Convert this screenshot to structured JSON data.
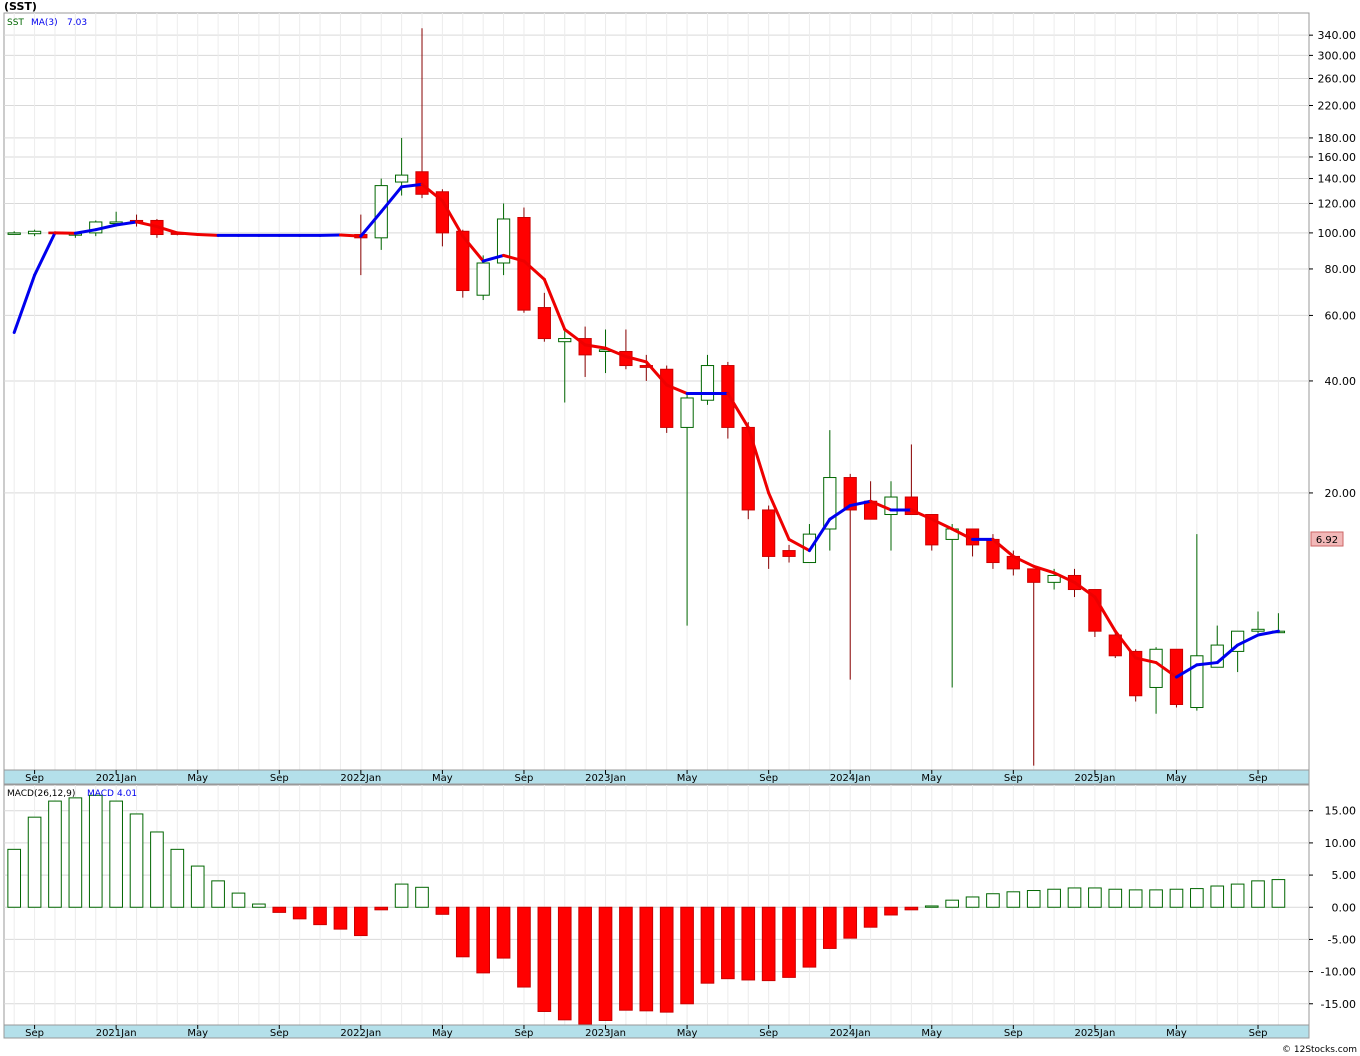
{
  "ticker_title": "(SST)",
  "price_panel": {
    "symbol": "SST",
    "ma_label": "MA(3)",
    "ma_value": "7.03",
    "last_price": "6.92"
  },
  "macd_panel": {
    "label": "MACD(26,12,9)",
    "macd_label": "MACD",
    "macd_value": "4.01"
  },
  "footer": "© 12Stocks.com",
  "colors": {
    "up": "#006600",
    "down": "#cc0000",
    "down_fill": "#ff0000",
    "ma_up": "#0000ee",
    "ma_down": "#ee0000",
    "axis_band": "#b4e0ea",
    "grid": "#d9d9d9",
    "last_price_bg": "#f2b8b8"
  },
  "chart_data": [
    {
      "type": "candlestick",
      "scale": "log",
      "ylim": [
        3.6,
        390
      ],
      "y_ticks": [
        20,
        40,
        60,
        80,
        100,
        120,
        140,
        160,
        180,
        220,
        260,
        300,
        340
      ],
      "y_tick_labels": [
        "20.00",
        "40.00",
        "60.00",
        "80.00",
        "100.00",
        "120.00",
        "140.00",
        "160.00",
        "180.00",
        "220.00",
        "260.00",
        "300.00",
        "340.00"
      ],
      "x_labels": [
        "Sep",
        "2021Jan",
        "May",
        "Sep",
        "2022Jan",
        "May",
        "Sep",
        "2023Jan",
        "May",
        "Sep",
        "2024Jan",
        "May",
        "Sep",
        "2025Jan",
        "May",
        "Sep"
      ],
      "x_label_index": [
        1,
        5,
        9,
        13,
        17,
        21,
        25,
        29,
        33,
        37,
        41,
        45,
        49,
        53,
        57,
        61
      ],
      "candles": [
        {
          "i": 0,
          "o": 100,
          "h": 101,
          "l": 99,
          "c": 100
        },
        {
          "i": 1,
          "o": 99.5,
          "h": 102,
          "l": 98,
          "c": 101
        },
        {
          "i": 2,
          "o": 100.5,
          "h": 101,
          "l": 99,
          "c": 99.5
        },
        {
          "i": 3,
          "o": 99,
          "h": 100,
          "l": 97,
          "c": 99.5
        },
        {
          "i": 4,
          "o": 100,
          "h": 108,
          "l": 98,
          "c": 107
        },
        {
          "i": 5,
          "o": 106,
          "h": 114,
          "l": 104,
          "c": 107
        },
        {
          "i": 6,
          "o": 108,
          "h": 112,
          "l": 104,
          "c": 107
        },
        {
          "i": 7,
          "o": 108,
          "h": 109,
          "l": 97,
          "c": 99
        },
        {
          "i": 8,
          "o": 100,
          "h": 100,
          "l": 98.5,
          "c": 99.5
        },
        {
          "i": 17,
          "o": 99,
          "h": 112,
          "l": 77,
          "c": 97
        },
        {
          "i": 18,
          "o": 97,
          "h": 140,
          "l": 90,
          "c": 134
        },
        {
          "i": 19,
          "o": 137,
          "h": 180,
          "l": 126,
          "c": 143
        },
        {
          "i": 20,
          "o": 146,
          "h": 355,
          "l": 124,
          "c": 127
        },
        {
          "i": 21,
          "o": 129,
          "h": 131,
          "l": 92,
          "c": 100
        },
        {
          "i": 22,
          "o": 101,
          "h": 102,
          "l": 67,
          "c": 70
        },
        {
          "i": 23,
          "o": 68,
          "h": 87,
          "l": 66,
          "c": 83
        },
        {
          "i": 24,
          "o": 83,
          "h": 120,
          "l": 77,
          "c": 109
        },
        {
          "i": 25,
          "o": 110,
          "h": 117,
          "l": 61,
          "c": 62
        },
        {
          "i": 26,
          "o": 63,
          "h": 69,
          "l": 51,
          "c": 52
        },
        {
          "i": 27,
          "o": 51,
          "h": 55,
          "l": 35,
          "c": 52
        },
        {
          "i": 28,
          "o": 52,
          "h": 56,
          "l": 41,
          "c": 47
        },
        {
          "i": 29,
          "o": 48,
          "h": 55,
          "l": 42,
          "c": 48.5
        },
        {
          "i": 30,
          "o": 48,
          "h": 55,
          "l": 43,
          "c": 44
        },
        {
          "i": 31,
          "o": 44,
          "h": 47,
          "l": 40,
          "c": 43.5
        },
        {
          "i": 32,
          "o": 43,
          "h": 44,
          "l": 29,
          "c": 30
        },
        {
          "i": 33,
          "o": 30,
          "h": 37,
          "l": 8.8,
          "c": 36
        },
        {
          "i": 34,
          "o": 35.5,
          "h": 47,
          "l": 34.5,
          "c": 44
        },
        {
          "i": 35,
          "o": 44,
          "h": 45,
          "l": 28,
          "c": 30
        },
        {
          "i": 36,
          "o": 30,
          "h": 31,
          "l": 17,
          "c": 18
        },
        {
          "i": 37,
          "o": 18,
          "h": 18.5,
          "l": 12.5,
          "c": 13.5
        },
        {
          "i": 38,
          "o": 14,
          "h": 14.5,
          "l": 13,
          "c": 13.5
        },
        {
          "i": 39,
          "o": 13,
          "h": 16.5,
          "l": 13,
          "c": 15.5
        },
        {
          "i": 40,
          "o": 16,
          "h": 29.5,
          "l": 14,
          "c": 22
        },
        {
          "i": 41,
          "o": 22,
          "h": 22.5,
          "l": 6.3,
          "c": 18
        },
        {
          "i": 42,
          "o": 19,
          "h": 21.5,
          "l": 17,
          "c": 17
        },
        {
          "i": 43,
          "o": 17.5,
          "h": 21.5,
          "l": 14,
          "c": 19.5
        },
        {
          "i": 44,
          "o": 19.5,
          "h": 27,
          "l": 17.5,
          "c": 17.5
        },
        {
          "i": 45,
          "o": 17.5,
          "h": 17.5,
          "l": 14,
          "c": 14.5
        },
        {
          "i": 46,
          "o": 15,
          "h": 16.5,
          "l": 6.0,
          "c": 16
        },
        {
          "i": 47,
          "o": 16,
          "h": 16,
          "l": 13.5,
          "c": 14.5
        },
        {
          "i": 48,
          "o": 15,
          "h": 15.5,
          "l": 12.5,
          "c": 13
        },
        {
          "i": 49,
          "o": 13.5,
          "h": 14,
          "l": 12,
          "c": 12.5
        },
        {
          "i": 50,
          "o": 12.5,
          "h": 12.5,
          "l": 3.7,
          "c": 11.5
        },
        {
          "i": 51,
          "o": 11.5,
          "h": 12.5,
          "l": 11,
          "c": 12
        },
        {
          "i": 52,
          "o": 12,
          "h": 12.5,
          "l": 10.5,
          "c": 11
        },
        {
          "i": 53,
          "o": 11,
          "h": 11,
          "l": 8.2,
          "c": 8.5
        },
        {
          "i": 54,
          "o": 8.3,
          "h": 8.5,
          "l": 7.2,
          "c": 7.3
        },
        {
          "i": 55,
          "o": 7.5,
          "h": 7.6,
          "l": 5.5,
          "c": 5.7
        },
        {
          "i": 56,
          "o": 6.0,
          "h": 7.7,
          "l": 5.1,
          "c": 7.6
        },
        {
          "i": 57,
          "o": 7.6,
          "h": 7.6,
          "l": 5.3,
          "c": 5.4
        },
        {
          "i": 58,
          "o": 5.3,
          "h": 15.5,
          "l": 5.2,
          "c": 7.3
        },
        {
          "i": 59,
          "o": 6.8,
          "h": 8.8,
          "l": 6.8,
          "c": 7.8
        },
        {
          "i": 60,
          "o": 7.5,
          "h": 8.5,
          "l": 6.6,
          "c": 8.5
        },
        {
          "i": 61,
          "o": 8.5,
          "h": 9.6,
          "l": 8.4,
          "c": 8.6
        },
        {
          "i": 62,
          "o": 8.5,
          "h": 9.5,
          "l": 8.4,
          "c": 8.5
        }
      ],
      "ma_series": {
        "name": "MA(3)",
        "points": [
          [
            0,
            54
          ],
          [
            1,
            77
          ],
          [
            2,
            100
          ],
          [
            3,
            99.8
          ],
          [
            4,
            102
          ],
          [
            5,
            105
          ],
          [
            6,
            107
          ],
          [
            7,
            104
          ],
          [
            8,
            100
          ],
          [
            9,
            99
          ],
          [
            10,
            98.5
          ],
          [
            11,
            98.5
          ],
          [
            12,
            98.5
          ],
          [
            13,
            98.5
          ],
          [
            14,
            98.5
          ],
          [
            15,
            98.5
          ],
          [
            16,
            98.7
          ],
          [
            17,
            98
          ],
          [
            18,
            114
          ],
          [
            19,
            133
          ],
          [
            20,
            135
          ],
          [
            21,
            122
          ],
          [
            22,
            98
          ],
          [
            23,
            84
          ],
          [
            24,
            87
          ],
          [
            25,
            84
          ],
          [
            26,
            75
          ],
          [
            27,
            55
          ],
          [
            28,
            50
          ],
          [
            29,
            49
          ],
          [
            30,
            46.5
          ],
          [
            31,
            45
          ],
          [
            32,
            39
          ],
          [
            33,
            37
          ],
          [
            34,
            37
          ],
          [
            35,
            37
          ],
          [
            36,
            30
          ],
          [
            37,
            20
          ],
          [
            38,
            15
          ],
          [
            39,
            14
          ],
          [
            40,
            17
          ],
          [
            41,
            18.5
          ],
          [
            42,
            19
          ],
          [
            43,
            18
          ],
          [
            44,
            18
          ],
          [
            45,
            17
          ],
          [
            46,
            16
          ],
          [
            47,
            15
          ],
          [
            48,
            15
          ],
          [
            49,
            13.5
          ],
          [
            50,
            12.7
          ],
          [
            51,
            12.2
          ],
          [
            52,
            11.5
          ],
          [
            53,
            10.5
          ],
          [
            54,
            8.5
          ],
          [
            55,
            7.2
          ],
          [
            56,
            7.0
          ],
          [
            57,
            6.4
          ],
          [
            58,
            6.9
          ],
          [
            59,
            7.0
          ],
          [
            60,
            7.8
          ],
          [
            61,
            8.3
          ],
          [
            62,
            8.5
          ]
        ]
      },
      "plot_window": {
        "first_index": -0.5,
        "last_index": 63.5
      }
    },
    {
      "type": "bar",
      "title": "MACD(26,12,9)",
      "ylim": [
        -18.3,
        19
      ],
      "y_ticks": [
        15,
        10,
        5,
        0,
        -5,
        -10,
        -15
      ],
      "y_tick_labels": [
        "15.00",
        "10.00",
        "5.00",
        "0.00",
        "-5.00",
        "-10.00",
        "-15.00"
      ],
      "x_labels": [
        "Sep",
        "2021Jan",
        "May",
        "Sep",
        "2022Jan",
        "May",
        "Sep",
        "2023Jan",
        "May",
        "Sep",
        "2024Jan",
        "May",
        "Sep",
        "2025Jan",
        "May",
        "Sep"
      ],
      "x_label_index": [
        1,
        5,
        9,
        13,
        17,
        21,
        25,
        29,
        33,
        37,
        41,
        45,
        49,
        53,
        57,
        61
      ],
      "values": [
        9,
        14,
        16.5,
        17,
        17.4,
        16.5,
        14.5,
        11.7,
        9,
        6.4,
        4.1,
        2.2,
        0.5,
        -0.8,
        -1.8,
        -2.7,
        -3.4,
        -4.4,
        -0.4,
        3.6,
        3.1,
        -1.1,
        -7.7,
        -10.2,
        -7.9,
        -12.4,
        -16.2,
        -17.5,
        -18.2,
        -17.6,
        -16,
        -16.1,
        -16.3,
        -15,
        -11.8,
        -11.1,
        -11.3,
        -11.4,
        -10.9,
        -9.3,
        -6.4,
        -4.8,
        -3.1,
        -1.2,
        -0.4,
        0.2,
        1.1,
        1.6,
        2.1,
        2.4,
        2.6,
        2.8,
        3,
        3,
        2.8,
        2.7,
        2.7,
        2.8,
        2.9,
        3.3,
        3.6,
        4.1,
        4.3
      ]
    }
  ]
}
